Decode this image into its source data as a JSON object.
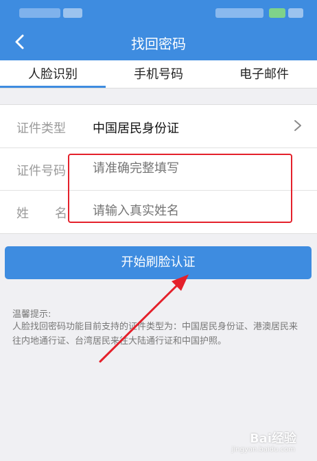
{
  "colors": {
    "accent": "#3e8ce0",
    "highlight": "#e4202a"
  },
  "navbar": {
    "title": "找回密码",
    "back_icon": "chevron-left-icon"
  },
  "tabs": [
    {
      "label": "人脸识别",
      "active": true
    },
    {
      "label": "手机号码",
      "active": false
    },
    {
      "label": "电子邮件",
      "active": false
    }
  ],
  "form": {
    "id_type": {
      "label": "证件类型",
      "value": "中国居民身份证"
    },
    "id_number": {
      "label": "证件号码",
      "placeholder": "请准确完整填写"
    },
    "name": {
      "label": "姓名",
      "placeholder": "请输入真实姓名"
    }
  },
  "primary_button": {
    "label": "开始刷脸认证"
  },
  "tips": {
    "title": "温馨提示:",
    "body": "人脸找回密码功能目前支持的证件类型为：中国居民身份证、港澳居民来往内地通行证、台湾居民来往大陆通行证和中国护照。"
  },
  "watermark": {
    "text": "Bai经验",
    "sub": "jingyan.baidu.com"
  }
}
